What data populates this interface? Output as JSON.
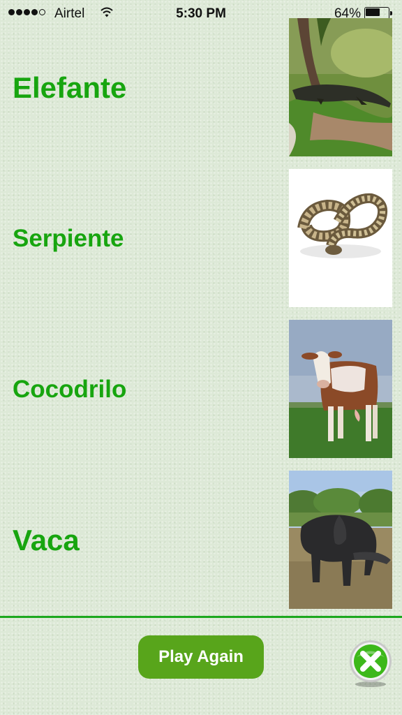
{
  "status_bar": {
    "carrier": "Airtel",
    "signal_bars_filled": 4,
    "signal_bars_total": 5,
    "time": "5:30 PM",
    "battery_percent": "64%",
    "battery_level": 0.64
  },
  "rows": [
    {
      "word": "Elefante",
      "image": "crocodile"
    },
    {
      "word": "Serpiente",
      "image": "snake"
    },
    {
      "word": "Cocodrilo",
      "image": "cow"
    },
    {
      "word": "Vaca",
      "image": "elephant"
    }
  ],
  "footer": {
    "play_again_label": "Play Again",
    "close_icon": "close-icon"
  },
  "colors": {
    "word_text": "#17a50f",
    "divider": "#1ba81d",
    "play_again_bg": "#58a51b",
    "close_icon": "#3db81b"
  }
}
